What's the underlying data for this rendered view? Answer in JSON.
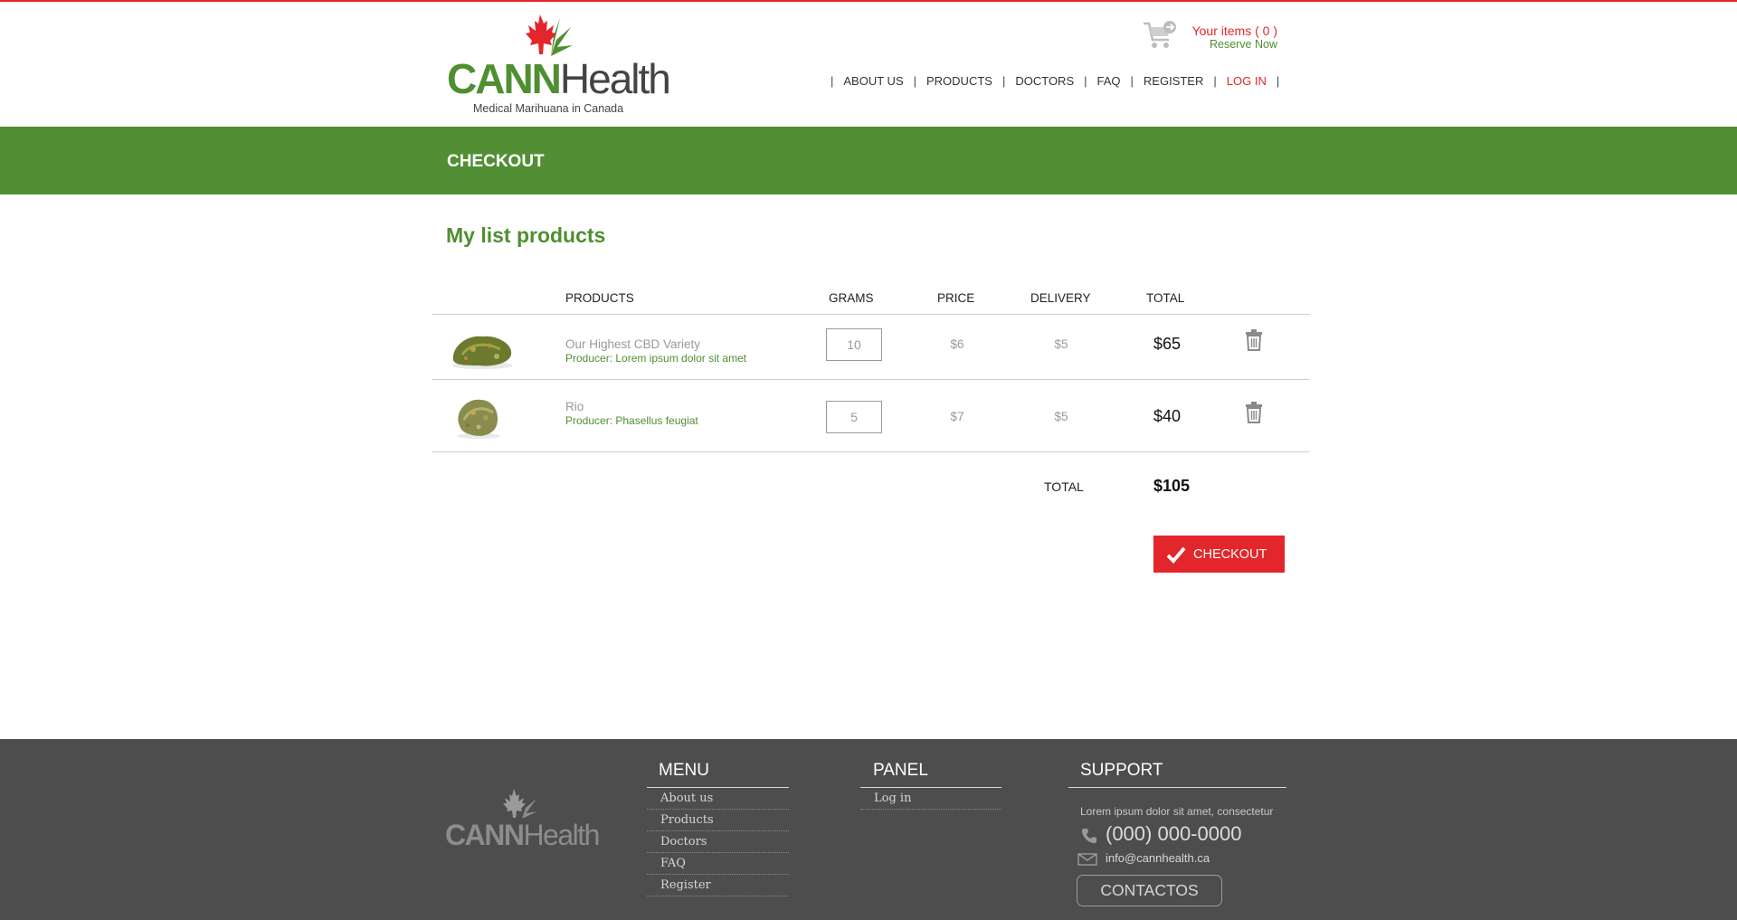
{
  "brand": {
    "name_bold": "CANN",
    "name_light": "Health",
    "tagline": "Medical Marihuana in Canada"
  },
  "cart": {
    "items_label": "Your items ( 0 )",
    "reserve_label": "Reserve Now"
  },
  "nav": {
    "items": [
      {
        "label": "ABOUT US"
      },
      {
        "label": "PRODUCTS"
      },
      {
        "label": "DOCTORS"
      },
      {
        "label": "FAQ"
      },
      {
        "label": "REGISTER"
      },
      {
        "label": "LOG IN"
      }
    ],
    "separator": "|"
  },
  "banner": {
    "title": "CHECKOUT"
  },
  "main": {
    "title": "My list products",
    "columns": {
      "products": "PRODUCTS",
      "grams": "GRAMS",
      "price": "PRICE",
      "delivery": "DELIVERY",
      "total": "TOTAL"
    },
    "rows": [
      {
        "name": "Our Highest CBD Variety",
        "producer": "Producer: Lorem ipsum dolor sit amet",
        "grams": "10",
        "price": "$6",
        "delivery": "$5",
        "total": "$65"
      },
      {
        "name": "Rio",
        "producer": "Producer: Phasellus feugiat",
        "grams": "5",
        "price": "$7",
        "delivery": "$5",
        "total": "$40"
      }
    ],
    "summary": {
      "total_label": "TOTAL",
      "total_value": "$105"
    },
    "checkout_label": "CHECKOUT"
  },
  "footer": {
    "menu": {
      "title": "MENU",
      "links": [
        "About us",
        "Products",
        "Doctors",
        "FAQ",
        "Register"
      ]
    },
    "panel": {
      "title": "PANEL",
      "links": [
        "Log in"
      ]
    },
    "support": {
      "title": "SUPPORT",
      "text": "Lorem ipsum dolor sit amet, consectetur",
      "phone": "(000) 000-0000",
      "email": "info@cannhealth.ca",
      "button": "CONTACTOS"
    }
  },
  "colors": {
    "brand_green": "#528f34",
    "accent_red": "#e3262b",
    "footer_bg": "#4d4d4d"
  },
  "icons": [
    "maple-leaf-icon",
    "cart-icon",
    "trash-icon",
    "checkmark-icon",
    "phone-icon",
    "mail-icon"
  ]
}
